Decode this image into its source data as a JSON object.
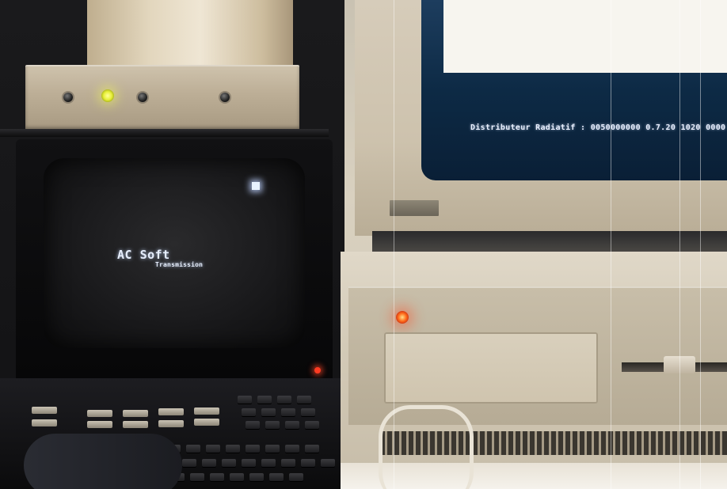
{
  "minitel": {
    "screen_title": "AC Soft",
    "screen_subtitle": "Transmission"
  },
  "monitor": {
    "status_line": "Distributeur Radiatif : 0050000000  0.7.20  1020  0000"
  },
  "colors": {
    "led_yellow": "#e8f03a",
    "led_red": "#ff3b22",
    "screen_blue": "#0d2a45"
  }
}
